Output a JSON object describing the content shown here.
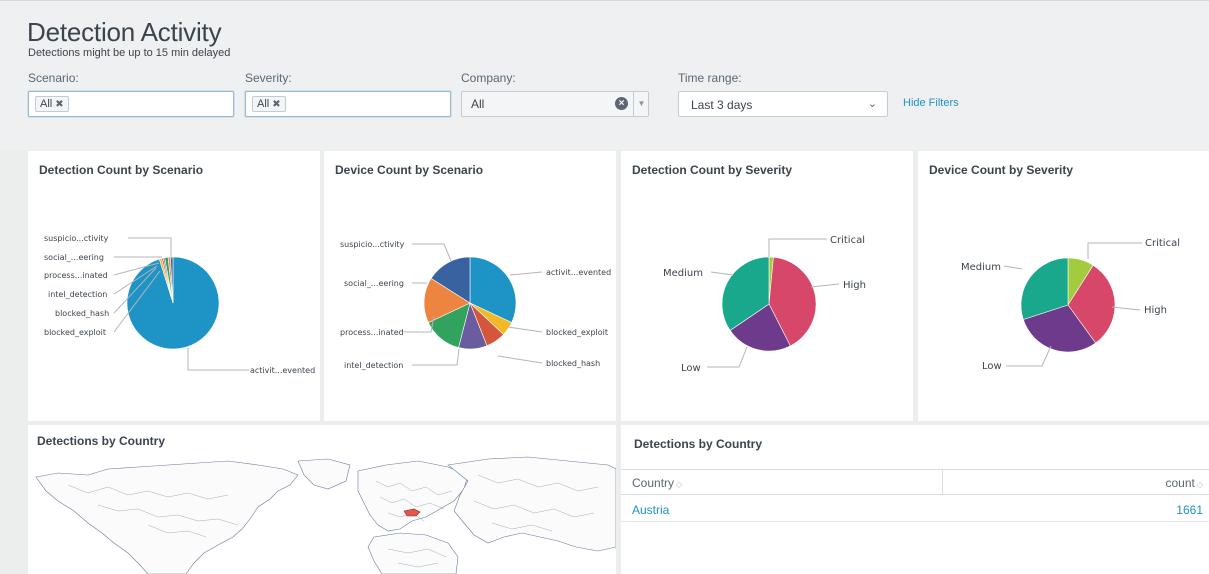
{
  "header": {
    "title": "Detection Activity",
    "subtitle": "Detections might be up to 15 min delayed",
    "hide_filters": "Hide Filters"
  },
  "filters": {
    "scenario": {
      "label": "Scenario:",
      "token": "All"
    },
    "severity": {
      "label": "Severity:",
      "token": "All"
    },
    "company": {
      "label": "Company:",
      "value": "All"
    },
    "time_range": {
      "label": "Time range:",
      "value": "Last 3 days"
    }
  },
  "panels": {
    "detection_count_scenario": {
      "title": "Detection Count by Scenario",
      "chart_data": {
        "type": "pie",
        "labels": [
          "activit...evented",
          "blocked_exploit",
          "blocked_hash",
          "intel_detection",
          "process...inated",
          "social_...eering",
          "suspicio...ctivity"
        ],
        "values": [
          95.2,
          0.8,
          0.6,
          0.5,
          1.2,
          0.8,
          0.9
        ],
        "colors": [
          "#1e93c6",
          "#f2b827",
          "#d6563c",
          "#6a5c9e",
          "#31a35f",
          "#ed8440",
          "#3863a0"
        ]
      }
    },
    "device_count_scenario": {
      "title": "Device Count by Scenario",
      "chart_data": {
        "type": "pie",
        "labels": [
          "activit...evented",
          "blocked_exploit",
          "blocked_hash",
          "intel_detection",
          "process...inated",
          "social_...eering",
          "suspicio...ctivity"
        ],
        "values": [
          32,
          5,
          7,
          10,
          14,
          16,
          16
        ],
        "colors": [
          "#1e93c6",
          "#f2b827",
          "#d6563c",
          "#6a5c9e",
          "#31a35f",
          "#ed8440",
          "#3863a0"
        ]
      }
    },
    "detection_count_severity": {
      "title": "Detection Count by Severity",
      "chart_data": {
        "type": "pie",
        "labels": [
          "Critical",
          "High",
          "Low",
          "Medium"
        ],
        "values": [
          1.5,
          41,
          23,
          34.5
        ],
        "colors": [
          "#a2cc3e",
          "#d6476a",
          "#6e3b8c",
          "#1aa88c"
        ]
      }
    },
    "device_count_severity": {
      "title": "Device Count by Severity",
      "chart_data": {
        "type": "pie",
        "labels": [
          "Critical",
          "High",
          "Low",
          "Medium"
        ],
        "values": [
          9,
          31,
          30,
          30
        ],
        "colors": [
          "#a2cc3e",
          "#d6476a",
          "#6e3b8c",
          "#1aa88c"
        ]
      }
    },
    "map": {
      "title": "Detections by Country"
    },
    "table": {
      "title": "Detections by Country",
      "columns": [
        "Country",
        "count"
      ],
      "rows": [
        {
          "country": "Austria",
          "count": "1661"
        }
      ]
    }
  }
}
